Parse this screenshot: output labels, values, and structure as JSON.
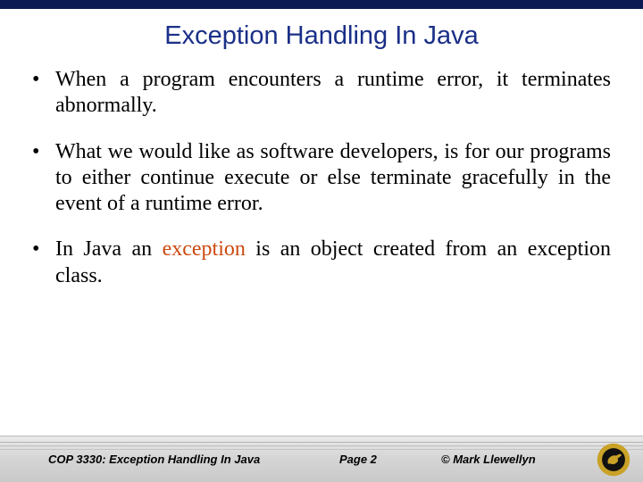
{
  "title": "Exception Handling In Java",
  "bullets": [
    {
      "pre": "When a program encounters a runtime error, it terminates abnormally.",
      "kw": "",
      "post": ""
    },
    {
      "pre": "What we would like as software developers, is for our programs to either continue execute or else terminate gracefully in the event of a run­time error.",
      "kw": "",
      "post": ""
    },
    {
      "pre": "In Java an ",
      "kw": "exception",
      "post": " is an object created from an exception class."
    }
  ],
  "footer": {
    "course": "COP 3330:  Exception Handling In Java",
    "page": "Page 2",
    "copyright": "© Mark Llewellyn"
  },
  "logo": {
    "name": "ucf-pegasus-seal",
    "outer_fill": "#c9a227",
    "inner_fill": "#111111"
  }
}
